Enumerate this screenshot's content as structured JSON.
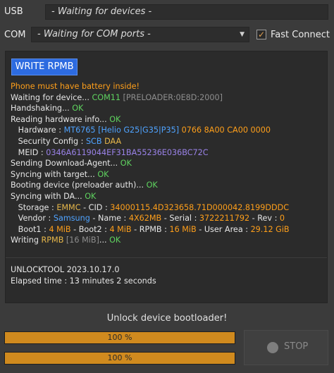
{
  "top": {
    "usb_label": "USB",
    "usb_value": "- Waiting for devices -",
    "com_label": "COM",
    "com_value": "- Waiting for COM ports -",
    "fast_connect_label": "Fast Connect",
    "fast_connect_checked": true
  },
  "panel": {
    "write_button_label": "WRITE RPMB",
    "log": {
      "warning": "Phone must have battery inside!",
      "waiting_text": "Waiting for device... ",
      "waiting_port": "COM11",
      "waiting_detail": "[PRELOADER:0E8D:2000]",
      "handshaking_text": "Handshaking... ",
      "handshaking_ok": "OK",
      "reading_text": "Reading hardware info... ",
      "reading_ok": "OK",
      "hardware_label": "Hardware : ",
      "hardware_chip": "MT6765 [Helio G25|G35|P35]",
      "hardware_codes": "0766 8A00 CA00 0000",
      "security_label": "Security Config : ",
      "security_scb": "SCB",
      "security_daa": "DAA",
      "meid_label": "MEID : ",
      "meid_value": "0346A6119044EF31BA55236E036BC72C",
      "sending_text": "Sending Download-Agent... ",
      "sending_ok": "OK",
      "syncing_text": "Syncing with target... ",
      "syncing_ok": "OK",
      "booting_text": "Booting device (preloader auth)... ",
      "booting_ok": "OK",
      "syncing_da_text": "Syncing with DA... ",
      "syncing_da_ok": "OK",
      "storage_label": "Storage : ",
      "storage_type": "EMMC",
      "storage_cid_label": " - CID : ",
      "storage_cid": "34000115.4D323658.71D000042.8199DDDC",
      "vendor_label": "Vendor : ",
      "vendor_value": "Samsung",
      "name_label": " - Name : ",
      "name_value": "4X62MB",
      "serial_label": " - Serial : ",
      "serial_value": "3722211792",
      "rev_label": " - Rev : ",
      "rev_value": "0",
      "boot1_label": "Boot1 : ",
      "boot1_value": "4 MiB",
      "boot2_label": " - Boot2 : ",
      "boot2_value": "4 MiB",
      "rpmb_label": " - RPMB : ",
      "rpmb_value": "16 MiB",
      "userarea_label": " - User Area : ",
      "userarea_value": "29.12 GiB",
      "writing_text": "Writing ",
      "writing_target": "RPMB",
      "writing_size": " [16 MiB]",
      "writing_dots": "... ",
      "writing_ok": "OK"
    },
    "footer": {
      "version": "UNLOCKTOOL 2023.10.17.0",
      "elapsed_label": "Elapsed time : ",
      "elapsed_value": "13 minutes 2 seconds"
    }
  },
  "status_text": "Unlock device bootloader!",
  "progress": [
    {
      "label": "100 %",
      "value": 1.0
    },
    {
      "label": "100 %",
      "value": 1.0
    }
  ],
  "stop_button_label": "STOP",
  "colors": {
    "accent_blue": "#2d6be0",
    "progress_fill": "#d08a1e",
    "ok_green": "#5fd35f",
    "warning_orange": "#ff9f1a"
  }
}
